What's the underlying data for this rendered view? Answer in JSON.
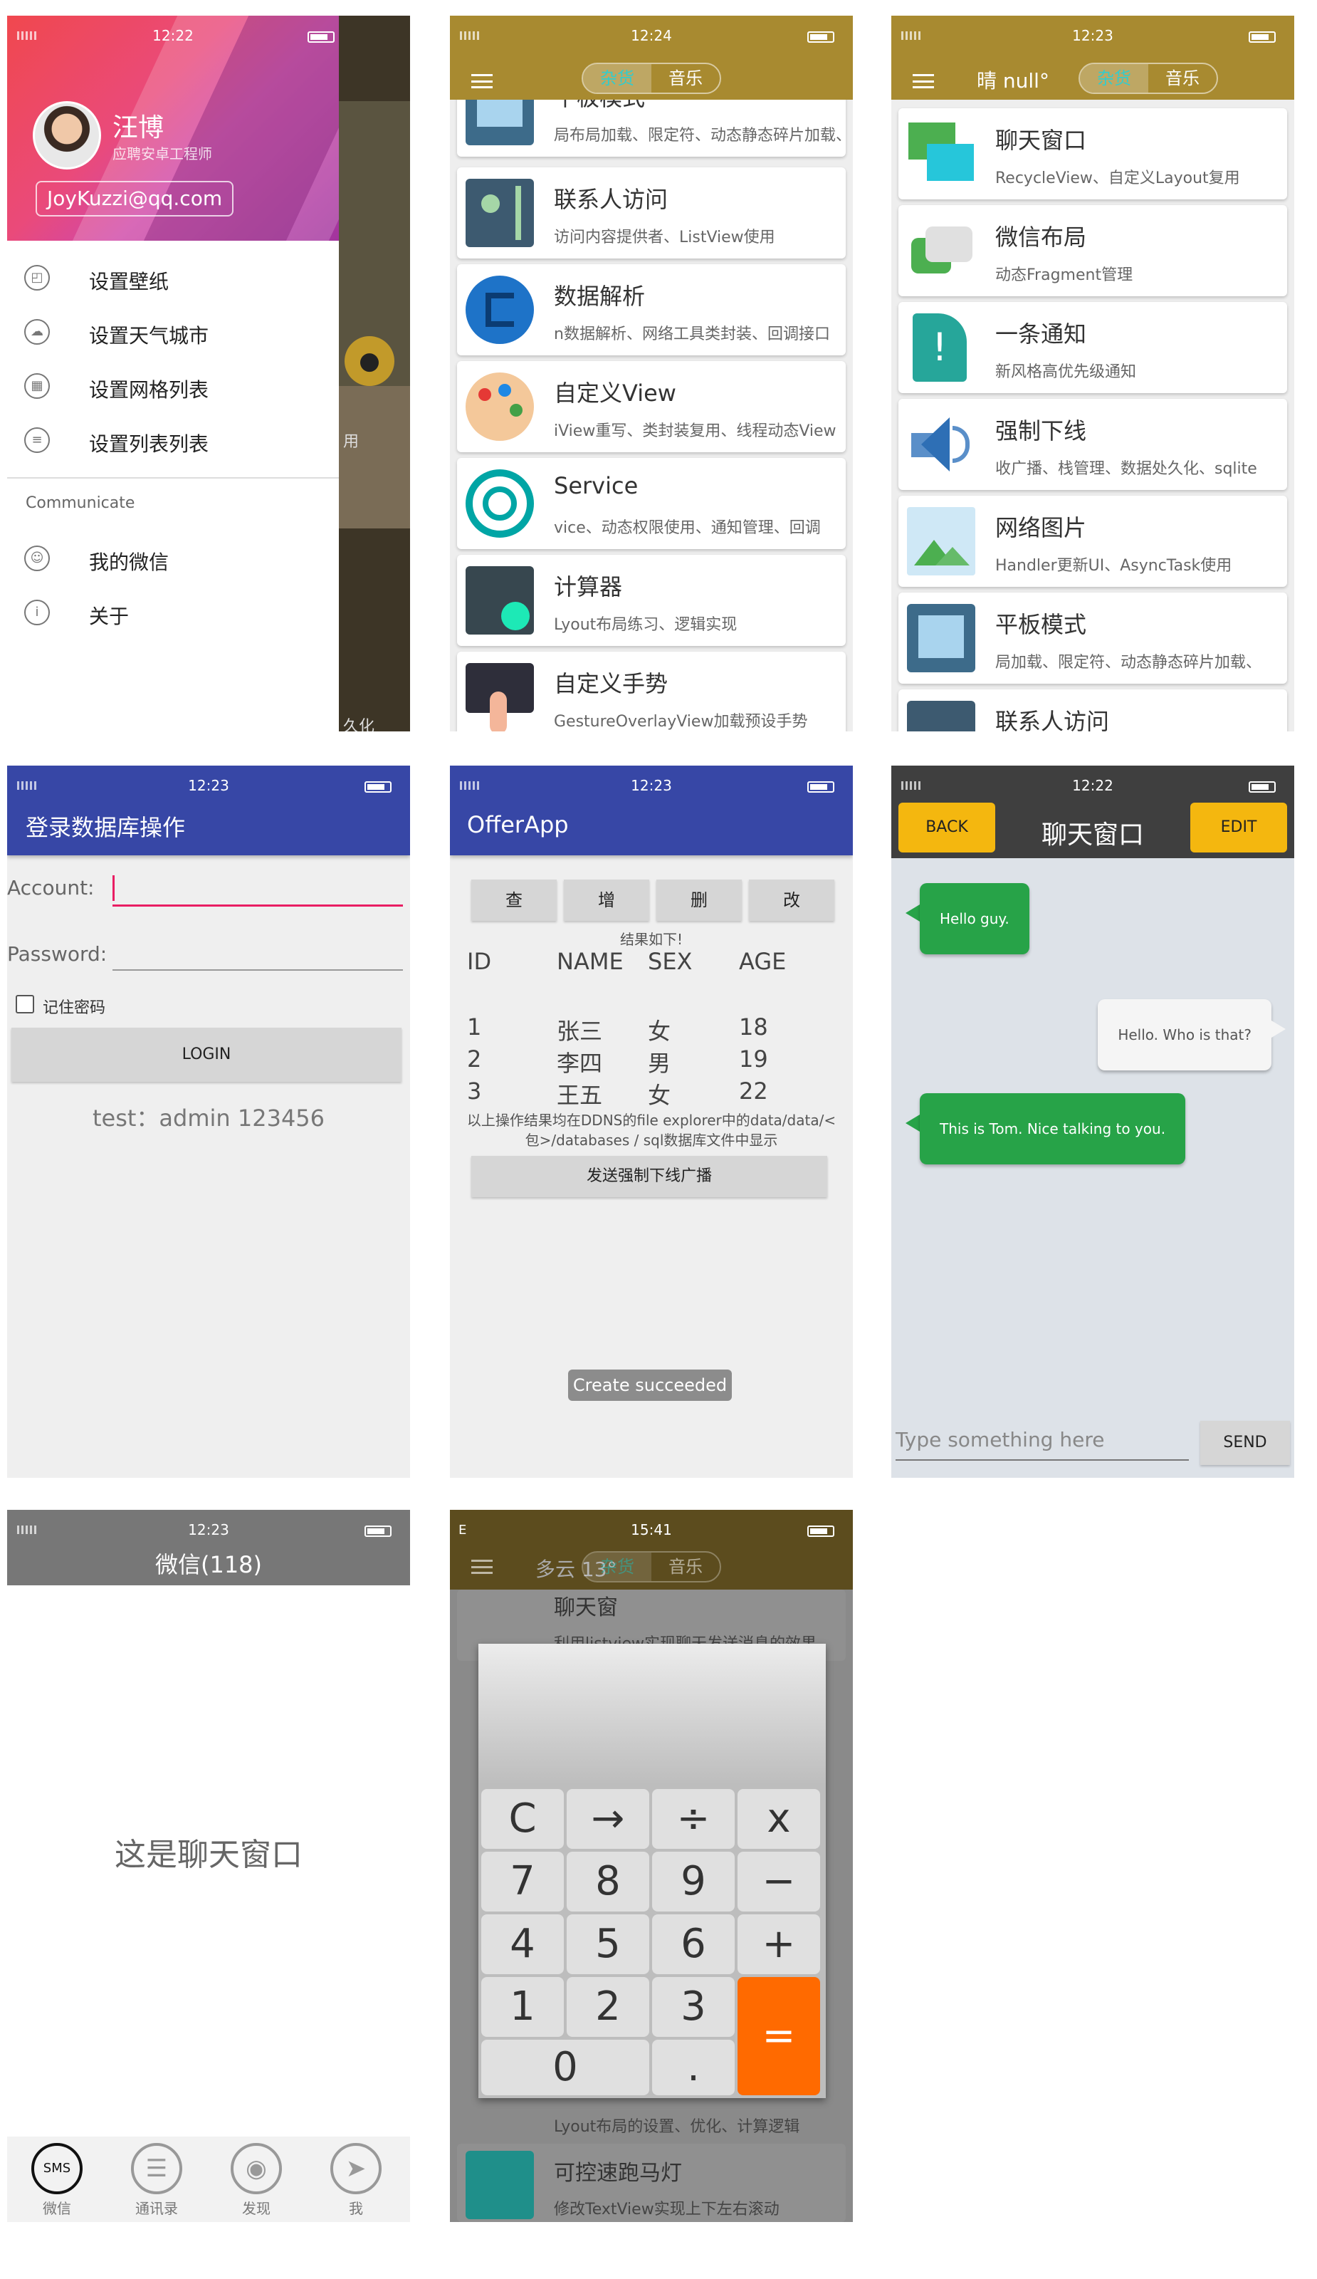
{
  "screen1": {
    "time": "12:22",
    "user": {
      "name": "汪博",
      "role": "应聘安卓工程师",
      "email": "JoyKuzzi@qq.com"
    },
    "items": [
      {
        "icon": "image-icon",
        "label": "设置壁纸"
      },
      {
        "icon": "cloud-icon",
        "label": "设置天气城市"
      },
      {
        "icon": "grid-icon",
        "label": "设置网格列表"
      },
      {
        "icon": "list-icon",
        "label": "设置列表列表"
      }
    ],
    "section": "Communicate",
    "items2": [
      {
        "icon": "chat-icon",
        "label": "我的微信"
      },
      {
        "icon": "info-icon",
        "label": "关于"
      }
    ],
    "peek_texts": [
      "用",
      "久化"
    ]
  },
  "screen2": {
    "time": "12:24",
    "tabs": [
      "杂货",
      "音乐"
    ],
    "cards": [
      {
        "title": "平板模式",
        "subtitle": "局布局加载、限定符、动态静态碎片加载、"
      },
      {
        "title": "联系人访问",
        "subtitle": "访问内容提供者、ListView使用"
      },
      {
        "title": "数据解析",
        "subtitle": "n数据解析、网络工具类封装、回调接口"
      },
      {
        "title": "自定义View",
        "subtitle": "iView重写、类封装复用、线程动态View"
      },
      {
        "title": "Service",
        "subtitle": "vice、动态权限使用、通知管理、回调"
      },
      {
        "title": "计算器",
        "subtitle": "Lyout布局练习、逻辑实现"
      },
      {
        "title": "自定义手势",
        "subtitle": "GestureOverlayView加载预设手势"
      }
    ]
  },
  "screen3": {
    "time": "12:23",
    "weather": "晴 null°",
    "tabs": [
      "杂货",
      "音乐"
    ],
    "cards": [
      {
        "title": "聊天窗口",
        "subtitle": "RecycleView、自定义Layout复用"
      },
      {
        "title": "微信布局",
        "subtitle": "动态Fragment管理"
      },
      {
        "title": "一条通知",
        "subtitle": "新风格高优先级通知"
      },
      {
        "title": "强制下线",
        "subtitle": "收广播、栈管理、数据处久化、sqlite"
      },
      {
        "title": "网络图片",
        "subtitle": "Handler更新UI、AsyncTask使用"
      },
      {
        "title": "平板模式",
        "subtitle": "局加载、限定符、动态静态碎片加载、"
      },
      {
        "title": "联系人访问",
        "subtitle": ""
      }
    ]
  },
  "screen4": {
    "time": "12:23",
    "title": "登录数据库操作",
    "account_label": "Account:",
    "password_label": "Password:",
    "remember": "记住密码",
    "login": "LOGIN",
    "hint": "test：admin 123456"
  },
  "screen5": {
    "time": "12:23",
    "title": "OfferApp",
    "buttons": [
      "查",
      "增",
      "删",
      "改"
    ],
    "result_label": "结果如下!",
    "headers": [
      "ID",
      "NAME",
      "SEX",
      "AGE"
    ],
    "rows": [
      [
        "1",
        "张三",
        "女",
        "18"
      ],
      [
        "2",
        "李四",
        "男",
        "19"
      ],
      [
        "3",
        "王五",
        "女",
        "22"
      ]
    ],
    "note": "以上操作结果均在DDNS的file explorer中的data/data/<包>/databases / sql数据库文件中显示",
    "broadcast": "发送强制下线广播",
    "toast": "Create succeeded"
  },
  "screen6": {
    "time": "12:22",
    "back": "BACK",
    "title": "聊天窗口",
    "edit": "EDIT",
    "messages": [
      {
        "side": "left",
        "text": "Hello guy."
      },
      {
        "side": "right",
        "text": "Hello. Who is that?"
      },
      {
        "side": "left",
        "text": "This is Tom. Nice talking to you."
      }
    ],
    "placeholder": "Type something here",
    "send": "SEND"
  },
  "screen7": {
    "time": "12:23",
    "title": "微信(118)",
    "body": "这是聊天窗口",
    "tabs": [
      {
        "icon": "sms-icon",
        "glyph": "SMS",
        "label": "微信"
      },
      {
        "icon": "contacts-icon",
        "glyph": "☰",
        "label": "通讯录"
      },
      {
        "icon": "gamepad-icon",
        "glyph": "◉",
        "label": "发现"
      },
      {
        "icon": "send-icon",
        "glyph": "➤",
        "label": "我"
      }
    ]
  },
  "screen8": {
    "time": "15:41",
    "carrier": "E",
    "weather": "多云 13°",
    "tabs": [
      "杂货",
      "音乐"
    ],
    "bg_cards": [
      {
        "title": "聊天窗",
        "subtitle": "利用listview实现聊天发送消息的效果"
      },
      {
        "title": "可控速跑马灯",
        "subtitle": "修改TextView实现上下左右滚动"
      }
    ],
    "bg_partial": "Lyout布局的设置、优化、计算逻辑",
    "keys": {
      "row1": [
        "C",
        "→",
        "÷",
        "x"
      ],
      "row2": [
        "7",
        "8",
        "9",
        "−"
      ],
      "row3": [
        "4",
        "5",
        "6",
        "+"
      ],
      "row4": [
        "1",
        "2",
        "3"
      ],
      "row5": [
        "0",
        "."
      ],
      "equals": "="
    }
  },
  "colors": {
    "gold": "#a88a30",
    "indigo": "#3747a6",
    "chat_green": "#27a348",
    "calc_orange": "#ff6a00",
    "edit_yellow": "#f4b70f"
  }
}
